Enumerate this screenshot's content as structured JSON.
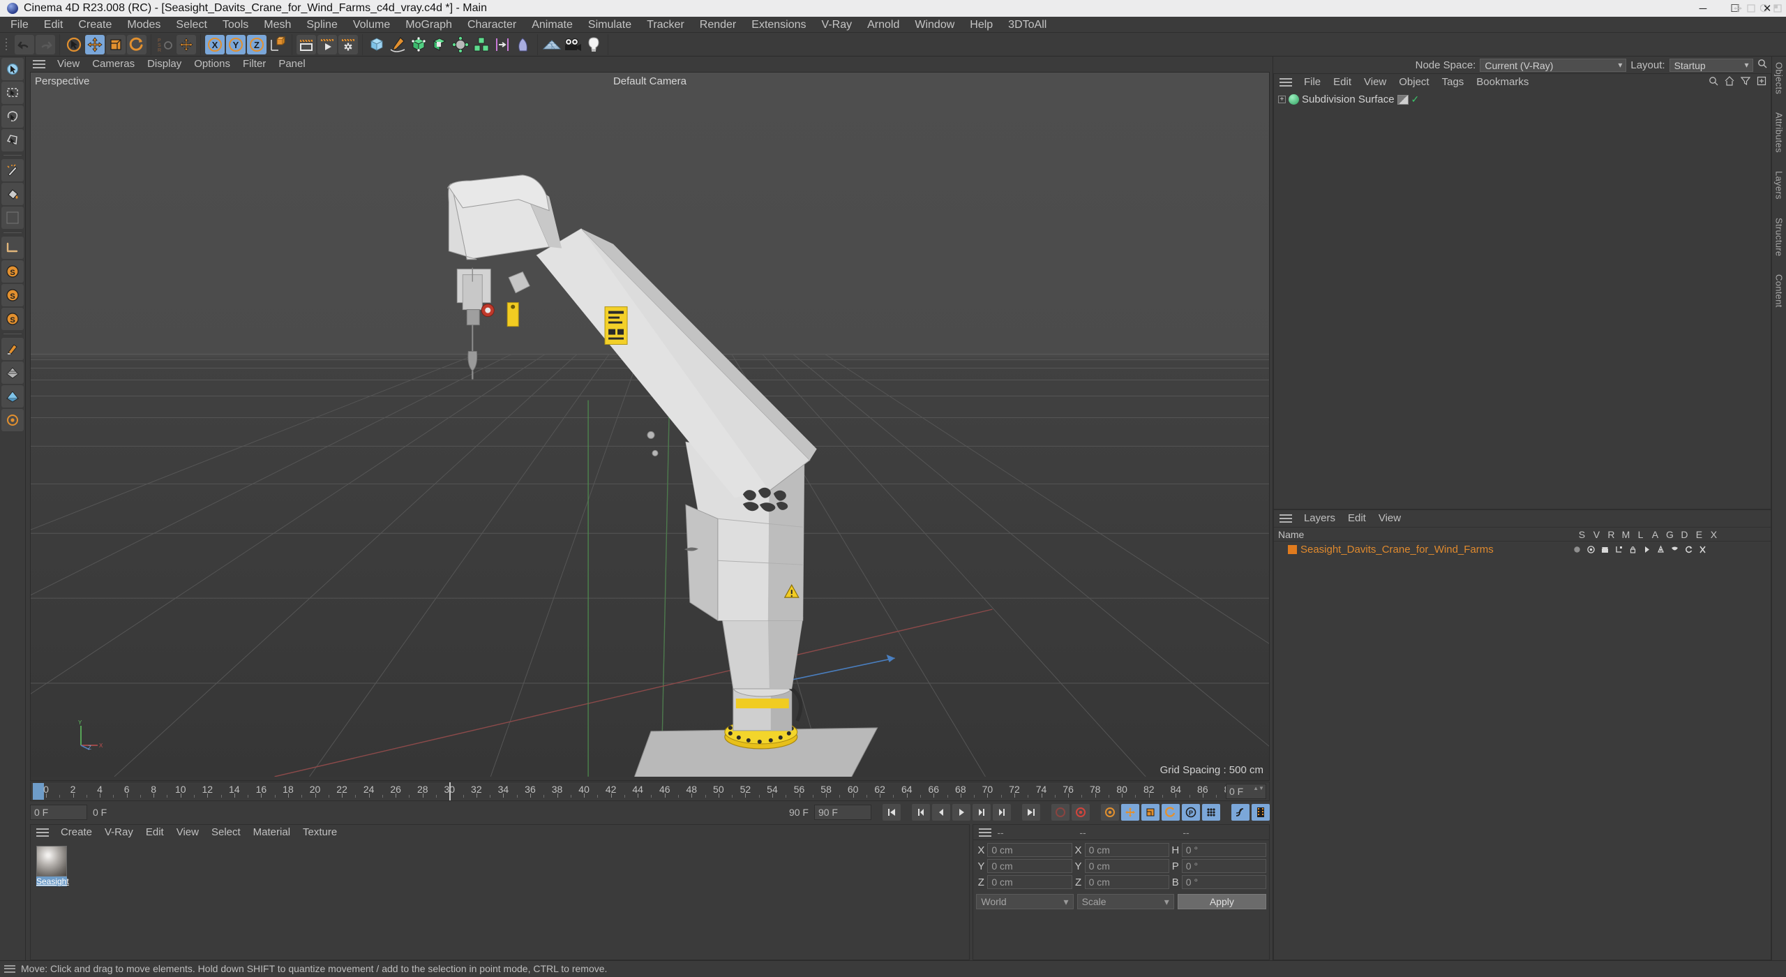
{
  "window": {
    "title": "Cinema 4D R23.008 (RC) - [Seasight_Davits_Crane_for_Wind_Farms_c4d_vray.c4d *] - Main",
    "minimize": "─",
    "maximize": "☐",
    "close": "✕"
  },
  "menubar": {
    "items": [
      "File",
      "Edit",
      "Create",
      "Modes",
      "Select",
      "Tools",
      "Mesh",
      "Spline",
      "Volume",
      "MoGraph",
      "Character",
      "Animate",
      "Simulate",
      "Tracker",
      "Render",
      "Extensions",
      "V-Ray",
      "Arnold",
      "Window",
      "Help",
      "3DToAll"
    ]
  },
  "toolbar": {
    "icons": [
      "undo-icon",
      "redo-icon",
      "live-select-icon",
      "move-icon",
      "scale-icon",
      "rotate-icon",
      "psr-lock-icon",
      "move-axis-icon",
      "lock-x-axis-icon",
      "lock-y-axis-icon",
      "lock-z-axis-icon",
      "world-object-coordinates-icon",
      "render-view-icon",
      "render-picture-viewer-icon",
      "render-settings-icon",
      "cube-primitive-icon",
      "spline-pen-icon",
      "subdivision-surface-icon",
      "extrude-icon",
      "array-icon",
      "cloner-icon",
      "symmetry-icon",
      "bend-deformer-icon",
      "floor-icon",
      "camera-icon",
      "light-icon"
    ]
  },
  "left_tools": {
    "icons": [
      "live-selection-icon",
      "rectangle-selection-icon",
      "lasso-selection-icon",
      "polygon-selection-icon",
      "magic-wand-selection-icon",
      "fill-selection-icon",
      "measure-construct-icon",
      "workplane-icon",
      "soft-selection-icon",
      "snap-settings-icon",
      "quantize-icon",
      "paint-icon",
      "workplane-lock-icon",
      "modeling-axis-icon",
      "deformer-icon"
    ]
  },
  "viewport": {
    "menu": [
      "View",
      "Cameras",
      "Display",
      "Options",
      "Filter",
      "Panel"
    ],
    "label_top_left": "Perspective",
    "label_top_center": "Default Camera",
    "grid_spacing": "Grid Spacing : 500 cm",
    "axis_labels": {
      "y": "Y",
      "x": "X",
      "z": "Z"
    },
    "corner_icons": [
      "viewport-maximize-icon",
      "viewport-move-icon",
      "viewport-scale-icon",
      "viewport-rotate-icon",
      "viewport-layout-icon"
    ]
  },
  "timeline": {
    "start": 0,
    "end": 90,
    "step": 2,
    "current_frame_field": "0 F",
    "playhead_frame": 30,
    "cursor_frame": 0
  },
  "transport": {
    "current_frame": "0 F",
    "current_frame_2": "0 F",
    "range_end": "90 F",
    "range_end_2": "90 F",
    "buttons": [
      "go-to-start-icon",
      "go-to-previous-keyframe-icon",
      "step-back-icon",
      "play-icon",
      "step-forward-icon",
      "go-to-next-keyframe-icon",
      "go-to-end-icon",
      "record-active-objects-icon",
      "autokeying-icon",
      "keyframe-selection-icon",
      "position-key-icon",
      "scale-key-icon",
      "rotation-key-icon",
      "parameter-key-icon",
      "point-level-animation-icon",
      "animation-mode-icon",
      "timeline-mode-icon"
    ]
  },
  "material_manager": {
    "menu": [
      "Create",
      "V-Ray",
      "Edit",
      "View",
      "Select",
      "Material",
      "Texture"
    ],
    "materials": [
      {
        "name": "Seasight",
        "selected": true
      }
    ]
  },
  "coordinates": {
    "header": [
      "--",
      "--",
      "--"
    ],
    "rows": [
      {
        "a_label": "X",
        "a_value": "0 cm",
        "b_label": "X",
        "b_value": "0 cm",
        "c_label": "H",
        "c_value": "0 °"
      },
      {
        "a_label": "Y",
        "a_value": "0 cm",
        "b_label": "Y",
        "b_value": "0 cm",
        "c_label": "P",
        "c_value": "0 °"
      },
      {
        "a_label": "Z",
        "a_value": "0 cm",
        "b_label": "Z",
        "b_value": "0 cm",
        "c_label": "B",
        "c_value": "0 °"
      }
    ],
    "system": "World",
    "mode": "Scale",
    "apply": "Apply"
  },
  "nodespace": {
    "label": "Node Space:",
    "value": "Current (V-Ray)",
    "layout_label": "Layout:",
    "layout_value": "Startup"
  },
  "object_manager": {
    "menu": [
      "File",
      "Edit",
      "View",
      "Object",
      "Tags",
      "Bookmarks"
    ],
    "header_icons": [
      "search-icon",
      "home-icon",
      "filter-icon",
      "fullscreen-icon"
    ],
    "rail_label": "Objects",
    "objects": [
      {
        "name": "Subdivision Surface",
        "icon": "subdivision-surface-icon",
        "visible": true
      }
    ]
  },
  "layers_manager": {
    "menu": [
      "Layers",
      "Edit",
      "View"
    ],
    "columns": [
      "Name",
      "S",
      "V",
      "R",
      "M",
      "L",
      "A",
      "G",
      "D",
      "E",
      "X"
    ],
    "rows": [
      {
        "name": "Seasight_Davits_Crane_for_Wind_Farms",
        "color": "#e07b1e",
        "flags": [
          "solo-icon",
          "view-icon",
          "render-icon",
          "manager-icon",
          "lock-icon",
          "animation-icon",
          "generators-icon",
          "deformers-icon",
          "expressions-icon",
          "xref-icon"
        ]
      }
    ],
    "rail_labels": [
      "Attributes",
      "Layers",
      "Structure",
      "Content"
    ]
  },
  "statusbar": {
    "text": "Move: Click and drag to move elements. Hold down SHIFT to quantize movement / add to the selection in point mode, CTRL to remove."
  },
  "colors": {
    "accent_blue": "#7ba7d9",
    "orange": "#e07b1e",
    "panel_bg": "#3b3b3b",
    "viewport_bg": "#4a4a4a",
    "text": "#c8c8c8"
  }
}
